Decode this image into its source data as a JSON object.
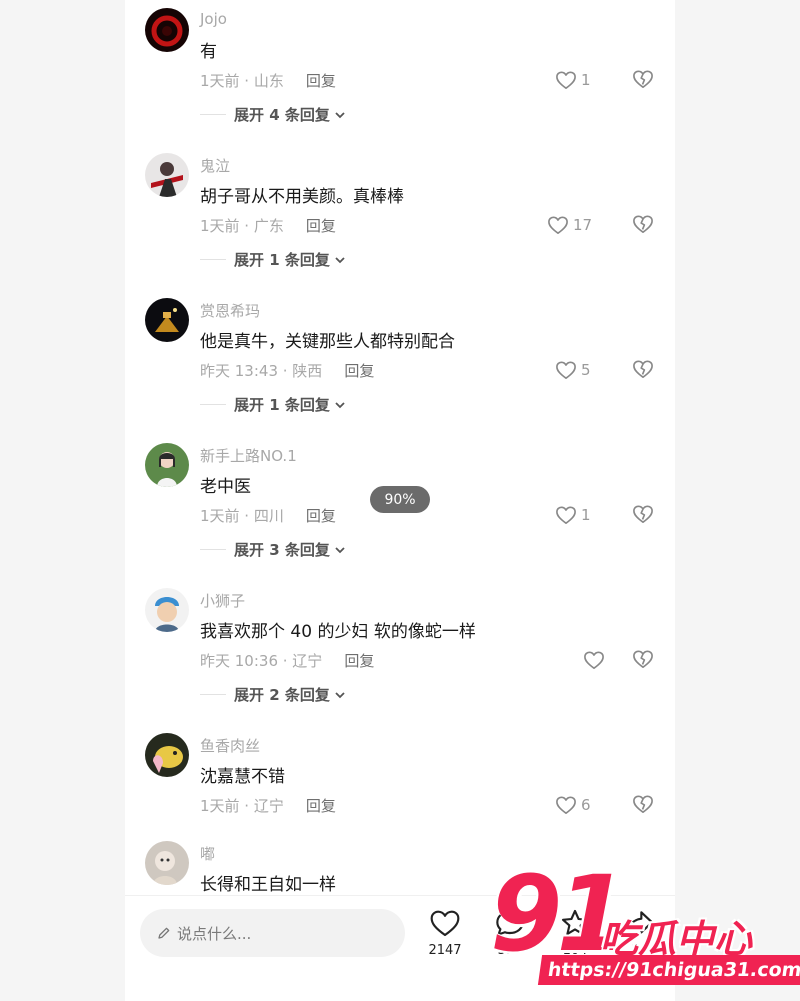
{
  "comments": [
    {
      "user": "Jojo",
      "text": "有",
      "meta": "1天前 · 山东",
      "reply": "回复",
      "likes": "1",
      "expand": "展开 4 条回复"
    },
    {
      "user": "鬼泣",
      "text": "胡子哥从不用美颜。真棒棒",
      "meta": "1天前 · 广东",
      "reply": "回复",
      "likes": "17",
      "expand": "展开 1 条回复"
    },
    {
      "user": "赏恩希玛",
      "text": "他是真牛，关键那些人都特别配合",
      "meta": "昨天 13:43 · 陕西",
      "reply": "回复",
      "likes": "5",
      "expand": "展开 1 条回复"
    },
    {
      "user": "新手上路NO.1",
      "text": "老中医",
      "meta": "1天前 · 四川",
      "reply": "回复",
      "likes": "1",
      "expand": "展开 3 条回复"
    },
    {
      "user": "小狮子",
      "text": "我喜欢那个 40 的少妇 软的像蛇一样",
      "meta": "昨天 10:36 · 辽宁",
      "reply": "回复",
      "likes": "",
      "expand": "展开 2 条回复"
    },
    {
      "user": "鱼香肉丝",
      "text": "沈嘉慧不错",
      "meta": "1天前 · 辽宁",
      "reply": "回复",
      "likes": "6",
      "expand": ""
    },
    {
      "user": "嘟",
      "text": "长得和王自如一样",
      "meta": "",
      "reply": "",
      "likes": "",
      "expand": ""
    }
  ],
  "zoom": "90%",
  "input": {
    "placeholder": "说点什么..."
  },
  "actions": [
    {
      "icon": "heart-icon",
      "count": "2147"
    },
    {
      "icon": "chat-icon",
      "count": "510"
    },
    {
      "icon": "star-icon",
      "count": "104"
    },
    {
      "icon": "share-icon",
      "count": "24"
    }
  ],
  "watermark": {
    "num": "91",
    "cn": "吃瓜中心",
    "url": "https://91chigua31.com"
  },
  "colors": {
    "accent": "#f02352",
    "text": "#1a1a1a",
    "muted": "#a8a8a8"
  }
}
